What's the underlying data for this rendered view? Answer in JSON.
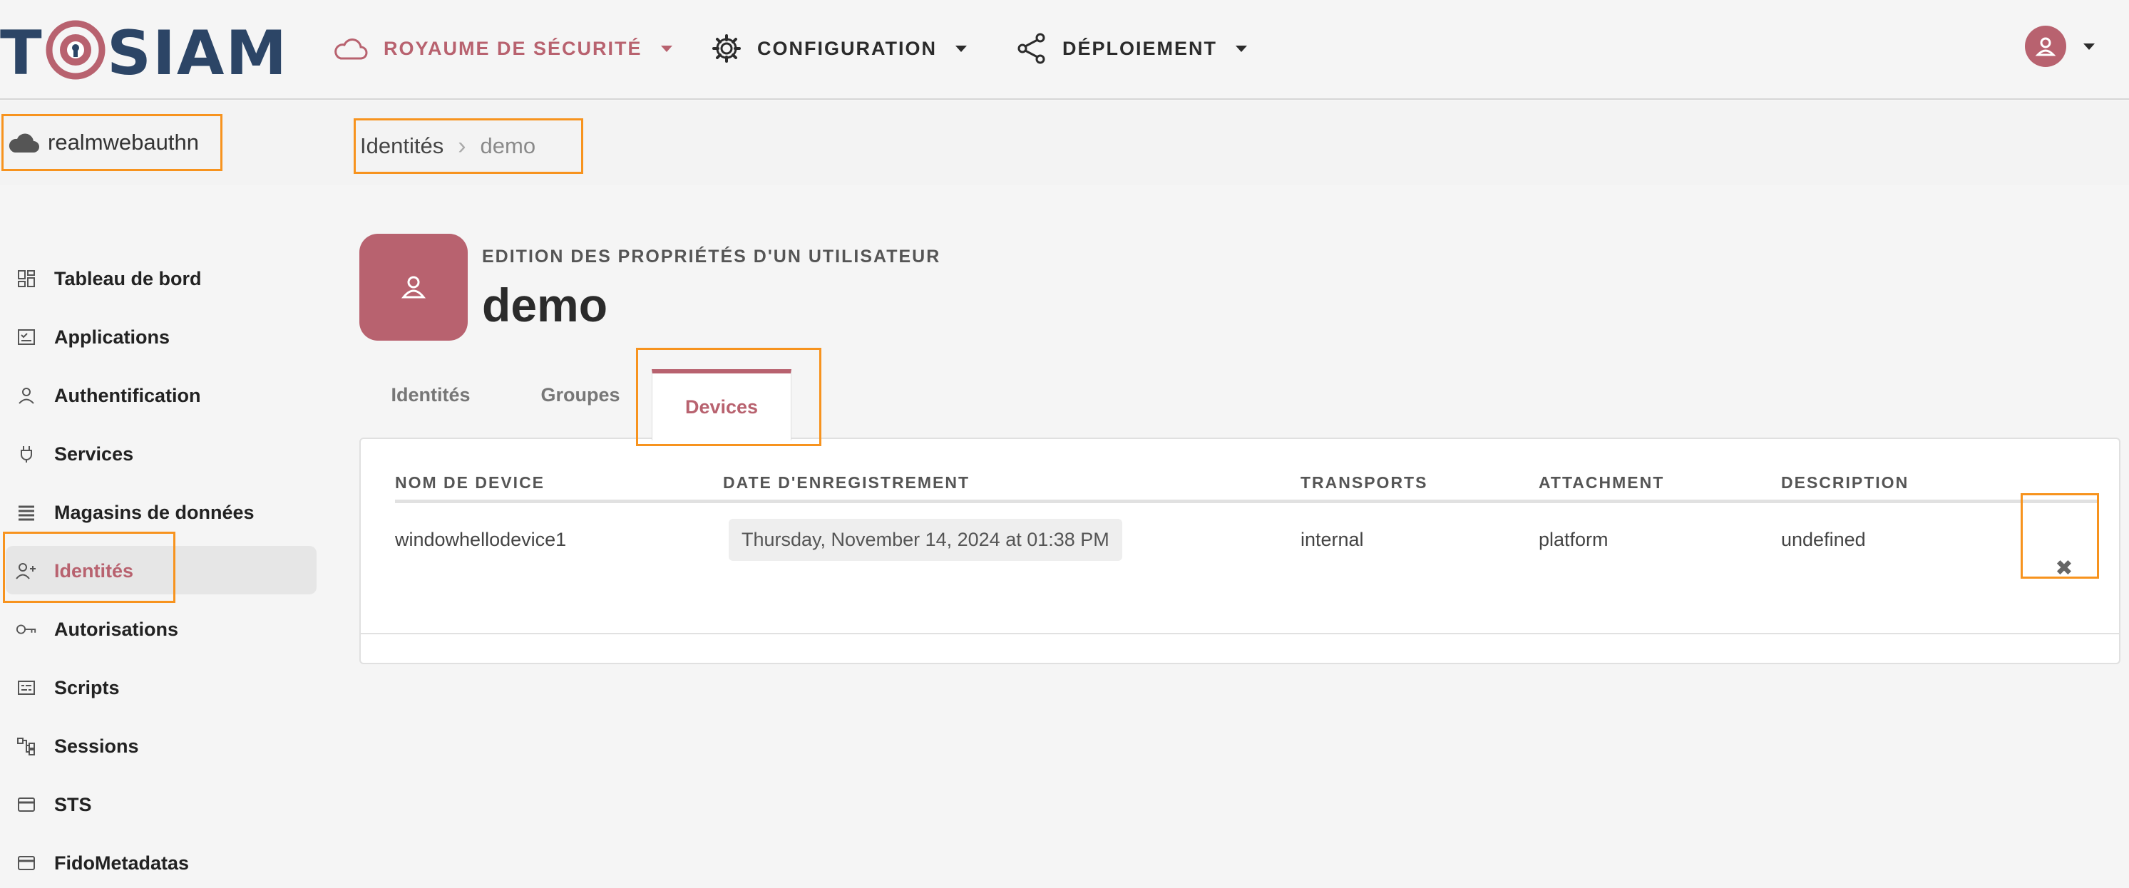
{
  "header": {
    "logo_text": "TOSIAM",
    "nav": [
      {
        "label": "ROYAUME DE SÉCURITÉ",
        "icon": "cloud-icon"
      },
      {
        "label": "CONFIGURATION",
        "icon": "gear-icon"
      },
      {
        "label": "DÉPLOIEMENT",
        "icon": "share-icon"
      }
    ]
  },
  "realm": {
    "name": "realmwebauthn"
  },
  "breadcrumb": {
    "root": "Identités",
    "current": "demo"
  },
  "sidebar": {
    "items": [
      {
        "label": "Tableau de bord",
        "icon": "dashboard-icon"
      },
      {
        "label": "Applications",
        "icon": "applications-icon"
      },
      {
        "label": "Authentification",
        "icon": "person-icon"
      },
      {
        "label": "Services",
        "icon": "plug-icon"
      },
      {
        "label": "Magasins de données",
        "icon": "list-icon"
      },
      {
        "label": "Identités",
        "icon": "add-person-icon"
      },
      {
        "label": "Autorisations",
        "icon": "key-icon"
      },
      {
        "label": "Scripts",
        "icon": "script-icon"
      },
      {
        "label": "Sessions",
        "icon": "sessions-icon"
      },
      {
        "label": "STS",
        "icon": "card-icon"
      },
      {
        "label": "FidoMetadatas",
        "icon": "card-icon"
      }
    ]
  },
  "user": {
    "subtitle": "EDITION DES PROPRIÉTÉS D'UN UTILISATEUR",
    "name": "demo"
  },
  "tabs": [
    "Identités",
    "Groupes",
    "Devices"
  ],
  "table": {
    "headers": [
      "NOM DE DEVICE",
      "DATE D'ENREGISTREMENT",
      "TRANSPORTS",
      "ATTACHMENT",
      "DESCRIPTION"
    ],
    "rows": [
      {
        "name": "windowhellodevice1",
        "date": "Thursday, November 14, 2024 at 01:38 PM",
        "transports": "internal",
        "attachment": "platform",
        "description": "undefined",
        "action": "✖"
      }
    ]
  },
  "colors": {
    "accent": "#b8626f",
    "brand": "#2c4566",
    "highlight": "#f7931e"
  }
}
